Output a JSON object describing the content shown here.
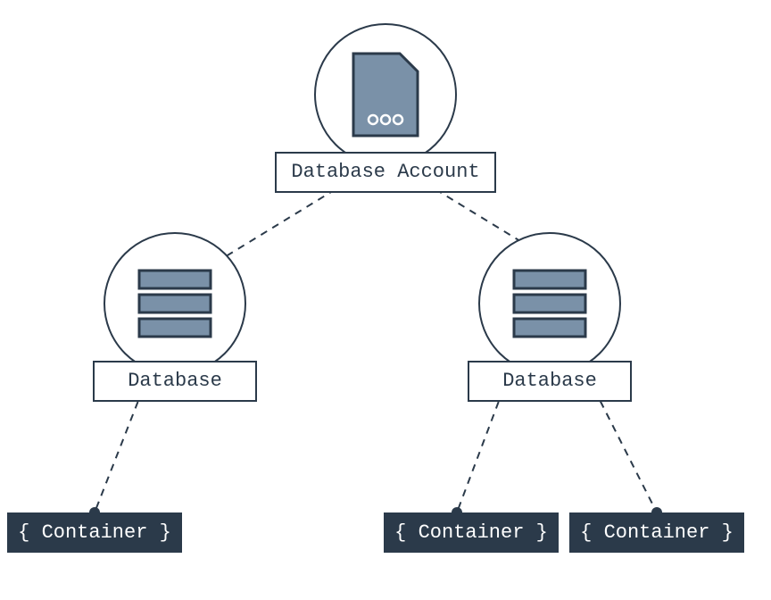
{
  "diagram": {
    "root": {
      "label": "Database Account"
    },
    "databases": [
      {
        "label": "Database"
      },
      {
        "label": "Database"
      }
    ],
    "containers": [
      {
        "label": "{ Container }"
      },
      {
        "label": "{ Container }"
      },
      {
        "label": "{ Container }"
      }
    ],
    "colors": {
      "stroke": "#2b3a4a",
      "fill": "#7a91a8",
      "dark": "#2b3a4a"
    }
  }
}
